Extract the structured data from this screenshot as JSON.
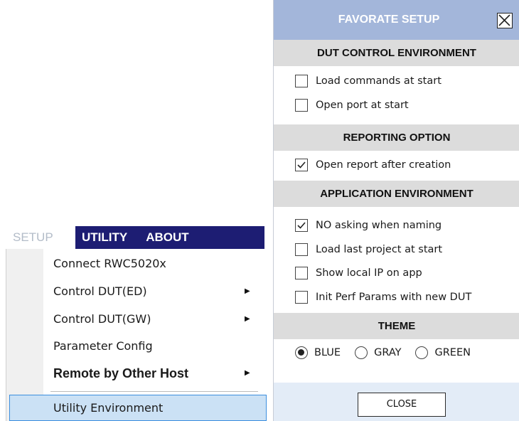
{
  "menubar": {
    "items": [
      {
        "label": "SETUP"
      },
      {
        "label": "UTILITY"
      },
      {
        "label": "ABOUT"
      }
    ]
  },
  "dropdown": {
    "items": [
      {
        "label": "Connect RWC5020x",
        "has_submenu": false
      },
      {
        "label": "Control DUT(ED)",
        "has_submenu": true
      },
      {
        "label": "Control DUT(GW)",
        "has_submenu": true
      },
      {
        "label": "Parameter Config",
        "has_submenu": false
      },
      {
        "label": "Remote by Other Host",
        "has_submenu": true,
        "bold": true
      },
      {
        "label": "Utility Environment",
        "has_submenu": false,
        "highlighted": true
      }
    ],
    "submenu_arrow": "▶"
  },
  "panel": {
    "title": "FAVORATE SETUP",
    "close_icon": "close-box-icon",
    "sections": [
      {
        "heading": "DUT CONTROL ENVIRONMENT",
        "options": [
          {
            "label": "Load commands at start",
            "checked": false
          },
          {
            "label": "Open port at start",
            "checked": false
          }
        ]
      },
      {
        "heading": "REPORTING OPTION",
        "options": [
          {
            "label": "Open report after creation",
            "checked": true
          }
        ]
      },
      {
        "heading": "APPLICATION ENVIRONMENT",
        "options": [
          {
            "label": "NO asking when naming",
            "checked": true
          },
          {
            "label": "Load last project at start",
            "checked": false
          },
          {
            "label": "Show local IP on app",
            "checked": false
          },
          {
            "label": "Init Perf Params with new DUT",
            "checked": false
          }
        ]
      },
      {
        "heading": "THEME",
        "radios": [
          {
            "label": "BLUE",
            "selected": true
          },
          {
            "label": "GRAY",
            "selected": false
          },
          {
            "label": "GREEN",
            "selected": false
          }
        ]
      }
    ],
    "close_button": "CLOSE"
  },
  "colors": {
    "menubar_bg": "#1d1d73",
    "panel_title_bg": "#a3b6da",
    "section_bg": "#dcdcdc",
    "highlight_bg": "#cbe1f5",
    "highlight_border": "#3b8ede",
    "footer_bg": "#e3ecf7"
  }
}
